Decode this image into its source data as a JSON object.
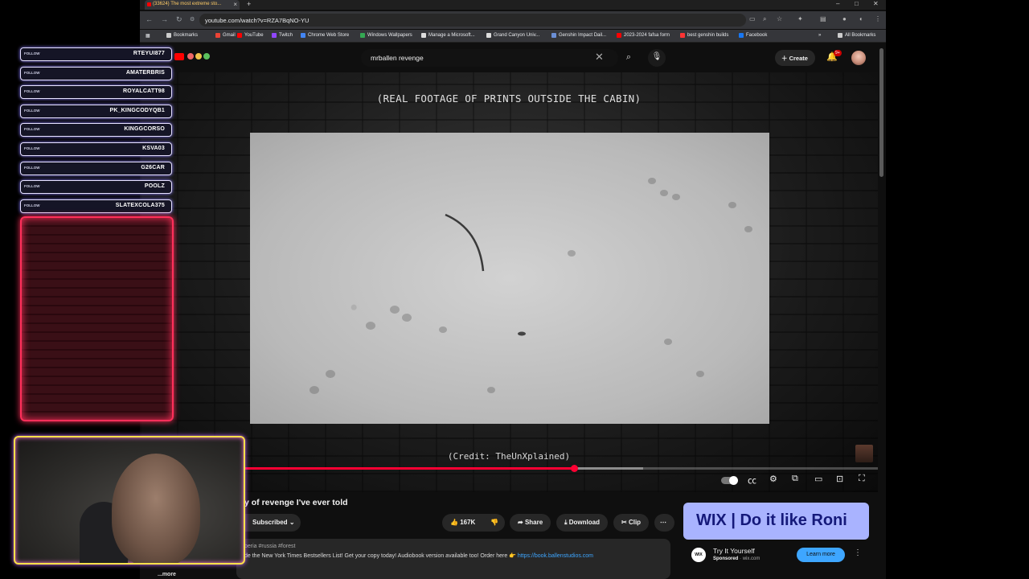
{
  "browser": {
    "tab_title": "(33624) The most extreme sto...",
    "url": "youtube.com/watch?v=RZA7BqNO-YU",
    "bookmarks": [
      {
        "label": "Bookmarks",
        "color": "#cccccc"
      },
      {
        "label": "Gmail",
        "color": "#ea4335"
      },
      {
        "label": "YouTube",
        "color": "#ff0000"
      },
      {
        "label": "Twitch",
        "color": "#9146ff"
      },
      {
        "label": "Chrome Web Store",
        "color": "#4285f4"
      },
      {
        "label": "Windows Wallpapers",
        "color": "#34a853"
      },
      {
        "label": "Manage a Microsoft...",
        "color": "#dddddd"
      },
      {
        "label": "Grand Canyon Univ...",
        "color": "#dddddd"
      },
      {
        "label": "Genshin Impact Dail...",
        "color": "#6b8fd6"
      },
      {
        "label": "2023-2024 fafsa form",
        "color": "#ff0000"
      },
      {
        "label": "best genshin builds",
        "color": "#ff3333"
      },
      {
        "label": "Facebook",
        "color": "#1877f2"
      }
    ],
    "all_bookmarks": "All Bookmarks"
  },
  "youtube": {
    "search_query": "mrballen revenge",
    "create_label": "Create",
    "notification_count": "9+"
  },
  "video": {
    "caption_top": "(REAL FOOTAGE OF PRINTS OUTSIDE THE CABIN)",
    "caption_bottom": "(Credit: TheUnXplained)",
    "progress_fraction": 0.52,
    "buffer_fraction": 0.63
  },
  "below_video": {
    "title": "y of revenge I've ever told",
    "subscribed_label": "Subscribed",
    "like_count": "167K",
    "share_label": "Share",
    "download_label": "Download",
    "clip_label": "Clip",
    "desc_tags": "beria #russia #forest",
    "desc_text": "de the New York Times Bestsellers List! Get your copy today! Audiobook version available too! Order here 👉",
    "desc_link": "https://book.ballenstudios.com",
    "more_label": "...more"
  },
  "ad": {
    "banner_text": "WIX | Do it like Roni",
    "logo_text": "WIX",
    "title": "Try It Yourself",
    "sponsored": "Sponsored",
    "domain": "wix.com",
    "cta": "Learn more"
  },
  "overlay": {
    "follow_label": "FOLLOW",
    "followers": [
      "RTEYUI877",
      "AMATERBRIS",
      "ROYALCATT98",
      "PK_KINGCODYQB1",
      "KINGGCORSO",
      "KSVA03",
      "G26CAR",
      "POOLZ",
      "SLATEXCOLA375"
    ]
  }
}
